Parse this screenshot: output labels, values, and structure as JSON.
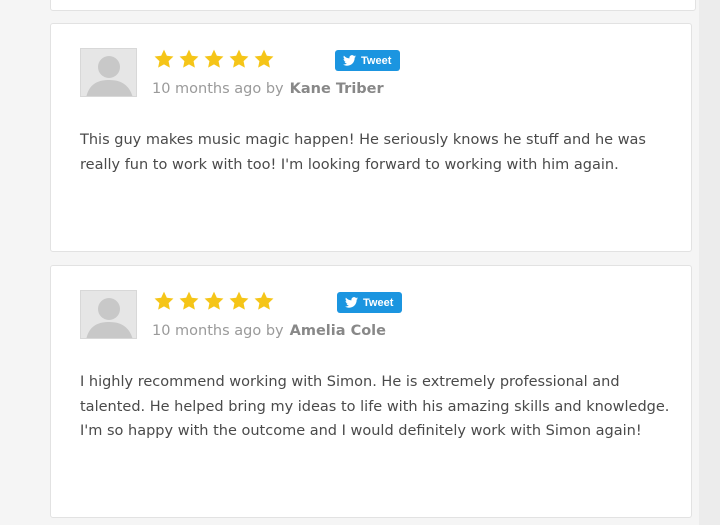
{
  "reviews": [
    {
      "rating": 5,
      "tweet_label": "Tweet",
      "time_ago": "10 months ago by",
      "author": "Kane Triber",
      "text": "This guy makes music magic happen! He seriously knows he stuff and he was really fun to work with too! I'm looking forward to working with him again."
    },
    {
      "rating": 5,
      "tweet_label": "Tweet",
      "time_ago": "10 months ago by",
      "author": "Amelia Cole",
      "text": "I highly recommend working with Simon. He is extremely professional and talented. He helped bring my ideas to life with his amazing skills and knowledge. I'm so happy with the outcome and I would definitely work with Simon again!"
    }
  ],
  "colors": {
    "star": "#f5c518",
    "tweet": "#1b95e0"
  },
  "icons": {
    "star": "star-icon",
    "twitter": "twitter-bird-icon",
    "avatar": "default-avatar-icon"
  }
}
